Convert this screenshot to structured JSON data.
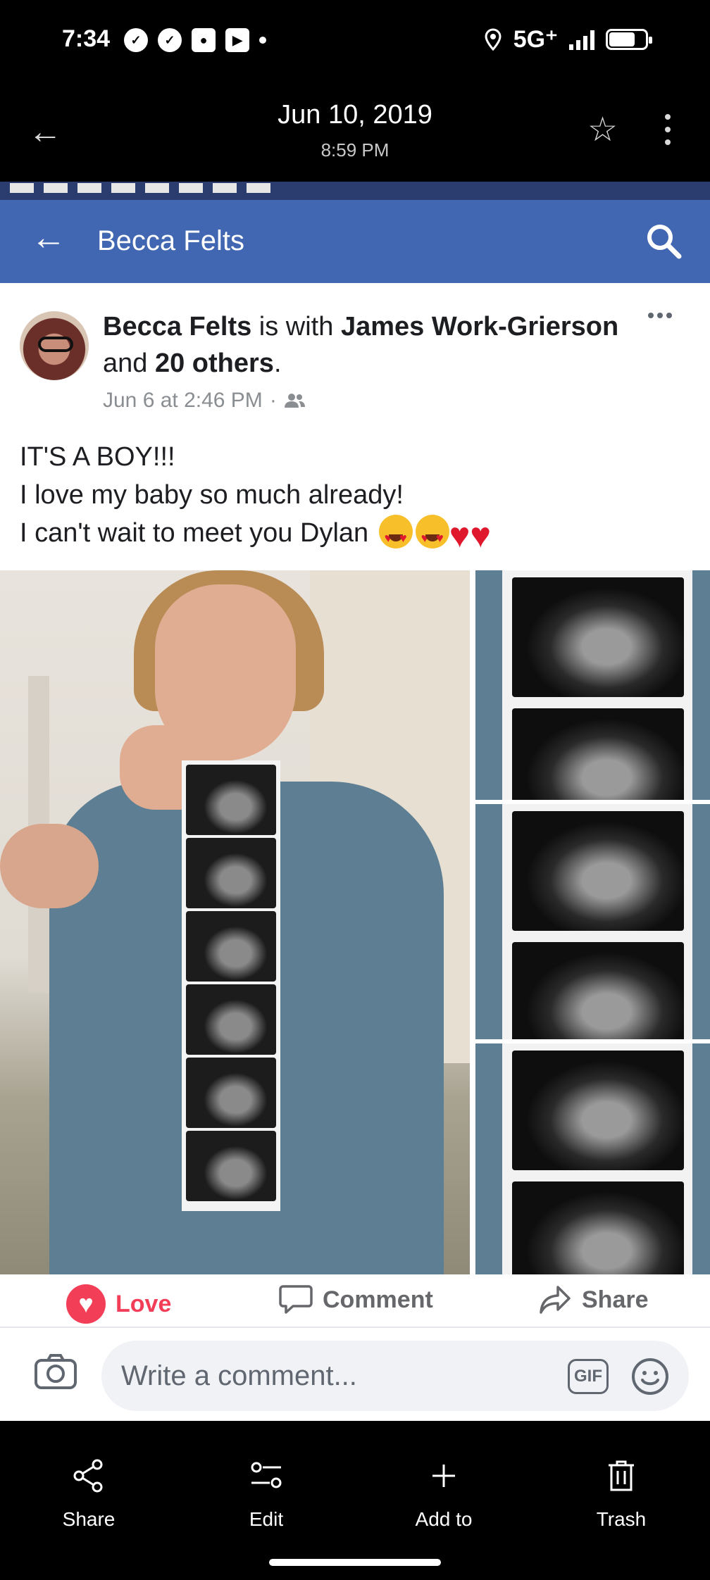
{
  "status_bar": {
    "time": "7:34",
    "network": "5G⁺",
    "left_icons": [
      "messenger-icon",
      "messenger-icon",
      "app-icon",
      "youtube-icon",
      "dot"
    ],
    "right_icons": [
      "location-icon",
      "signal-icon",
      "battery-icon"
    ]
  },
  "viewer": {
    "date": "Jun 10, 2019",
    "time": "8:59 PM"
  },
  "facebook": {
    "page_title": "Becca Felts",
    "post": {
      "author": "Becca Felts",
      "with_text": "is with",
      "tagged_person": "James Work-Grierson",
      "and_text": "and",
      "others": "20 others",
      "period": ".",
      "meta": "Jun 6 at 2:46 PM",
      "lines": [
        "IT'S A BOY!!!",
        "I love my baby so much already!",
        "I can't wait to meet you Dylan"
      ],
      "emojis": [
        "heart-eyes-emoji",
        "heart-eyes-emoji",
        "red-heart-emoji",
        "red-heart-emoji"
      ]
    },
    "reactions": {
      "love": "Love",
      "comment": "Comment",
      "share": "Share"
    },
    "comment_box": {
      "placeholder": "Write a comment...",
      "gif": "GIF"
    },
    "colors": {
      "brand": "#4267b2",
      "love": "#f33e58"
    }
  },
  "bottom_actions": [
    {
      "label": "Share",
      "icon": "share-icon"
    },
    {
      "label": "Edit",
      "icon": "edit-sliders-icon"
    },
    {
      "label": "Add to",
      "icon": "plus-icon"
    },
    {
      "label": "Trash",
      "icon": "trash-icon"
    }
  ]
}
